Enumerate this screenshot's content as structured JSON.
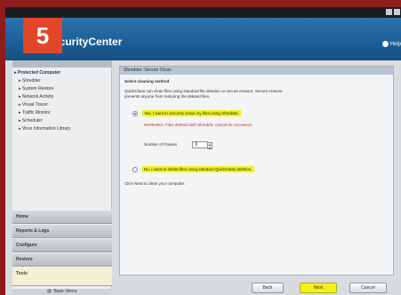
{
  "step_badge": "5",
  "app": {
    "title": "SecurityCenter",
    "help_label": "Help"
  },
  "sidebar": {
    "tree": [
      {
        "label": "Protected Computer",
        "root": true
      },
      {
        "label": "Shredder",
        "root": false
      },
      {
        "label": "System Restore",
        "root": false
      },
      {
        "label": "Network Activity",
        "root": false
      },
      {
        "label": "Visual Tracer",
        "root": false
      },
      {
        "label": "Traffic Monitor",
        "root": false
      },
      {
        "label": "Scheduler",
        "root": false
      },
      {
        "label": "Virus Information Library",
        "root": false
      }
    ],
    "nav": [
      "Home",
      "Reports & Logs",
      "Configure",
      "Restore",
      "Tools"
    ],
    "active_nav": "Tools",
    "footer": "Basic Menu"
  },
  "panel": {
    "title": "Shredder: Secure Clean",
    "subheading": "Select cleaning method",
    "description_1": "QuickClean can clean files using standard file deletion or secure erasure. Secure erasure",
    "description_2": "prevents anyone from restoring the deleted files.",
    "option_secure": "Yes, I want to securely erase my files using Shredder.",
    "option_secure_warning": "WARNING: Files deleted with Shredder cannot be recovered.",
    "passes_label": "Number of Passes",
    "passes_value": "3",
    "option_standard": "No, I want to delete files using standard QuickClean deletion.",
    "footer_text": "Click Next to clean your computer."
  },
  "buttons": {
    "back": "Back",
    "next": "Next",
    "cancel": "Cancel"
  },
  "colors": {
    "accent": "#e2462a",
    "highlight": "#f2f218",
    "warning": "#cc2a2a",
    "header": "#1a5a92"
  },
  "icons": [
    "close-icon",
    "maximize-icon",
    "help-icon",
    "tree-expand-icon",
    "basic-menu-icon"
  ]
}
